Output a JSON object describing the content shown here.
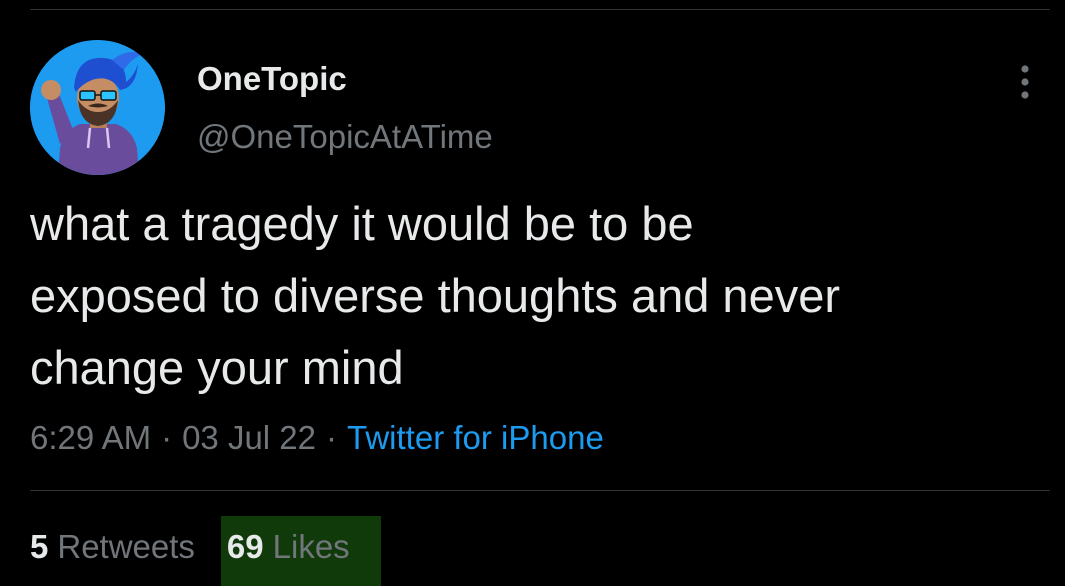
{
  "tweet": {
    "author": {
      "display_name": "OneTopic",
      "handle": "@OneTopicAtATime",
      "avatar_icon": "avatar-icon"
    },
    "more_icon": "more-options-icon",
    "text": "what a tragedy it would be to be\nexposed to diverse thoughts and never\nchange your mind",
    "meta": {
      "time": "6:29 AM",
      "separator": "·",
      "date": "03 Jul 22",
      "source": "Twitter for iPhone"
    },
    "stats": {
      "retweets": {
        "count": "5",
        "label": "Retweets"
      },
      "likes": {
        "count": "69",
        "label": "Likes"
      }
    }
  },
  "colors": {
    "background": "#000000",
    "text_primary": "#e7e9ea",
    "text_secondary": "#71767b",
    "accent": "#1d9bf0",
    "divider": "#2f3336",
    "highlight": "#113a0a"
  }
}
